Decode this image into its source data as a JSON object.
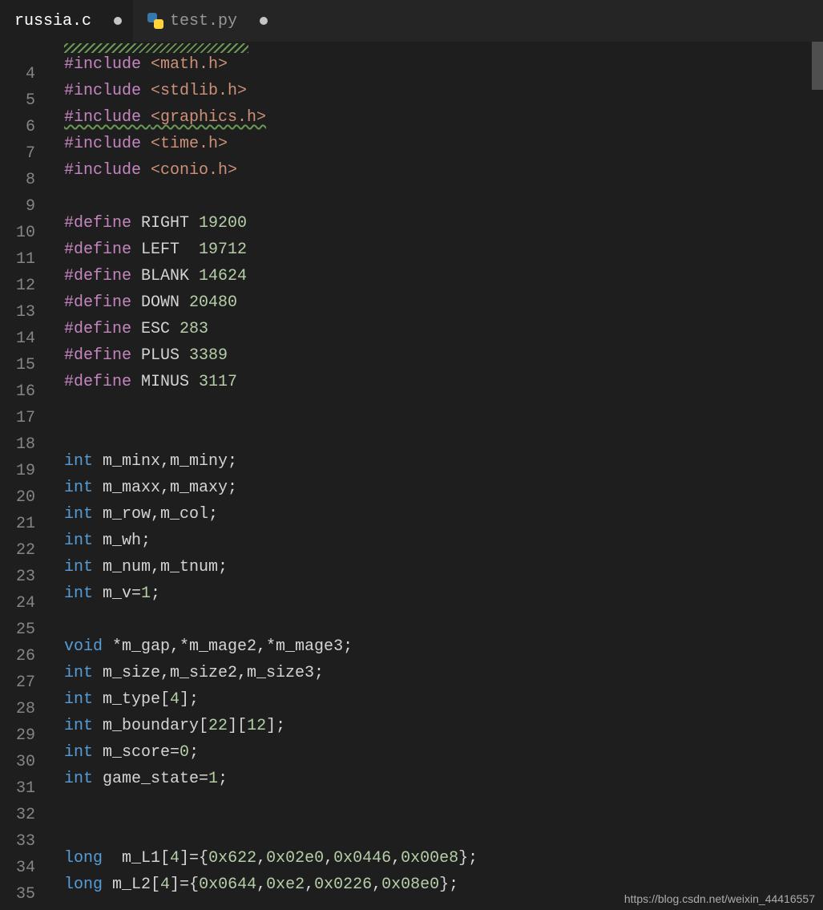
{
  "tabs": [
    {
      "label": "russia.c",
      "active": true,
      "icon": null,
      "modified": true
    },
    {
      "label": "test.py",
      "active": false,
      "icon": "python",
      "modified": true
    }
  ],
  "line_start": 4,
  "lines": [
    {
      "n": 4,
      "tokens": [
        {
          "t": "#include ",
          "c": "tok-pp"
        },
        {
          "t": "<math.h>",
          "c": "tok-hdr"
        }
      ]
    },
    {
      "n": 5,
      "tokens": [
        {
          "t": "#include ",
          "c": "tok-pp"
        },
        {
          "t": "<stdlib.h>",
          "c": "tok-hdr"
        }
      ]
    },
    {
      "n": 6,
      "tokens": [
        {
          "t": "#include ",
          "c": "tok-pp",
          "sq": true
        },
        {
          "t": "<graphics.h>",
          "c": "tok-hdr",
          "sq": true
        }
      ]
    },
    {
      "n": 7,
      "tokens": [
        {
          "t": "#include ",
          "c": "tok-pp"
        },
        {
          "t": "<time.h>",
          "c": "tok-hdr"
        }
      ]
    },
    {
      "n": 8,
      "tokens": [
        {
          "t": "#include ",
          "c": "tok-pp"
        },
        {
          "t": "<conio.h>",
          "c": "tok-hdr"
        }
      ]
    },
    {
      "n": 9,
      "tokens": []
    },
    {
      "n": 10,
      "tokens": [
        {
          "t": "#define",
          "c": "tok-pp"
        },
        {
          "t": " RIGHT ",
          "c": "tok-macro"
        },
        {
          "t": "19200",
          "c": "tok-num"
        }
      ]
    },
    {
      "n": 11,
      "tokens": [
        {
          "t": "#define",
          "c": "tok-pp"
        },
        {
          "t": " LEFT  ",
          "c": "tok-macro"
        },
        {
          "t": "19712",
          "c": "tok-num"
        }
      ]
    },
    {
      "n": 12,
      "tokens": [
        {
          "t": "#define",
          "c": "tok-pp"
        },
        {
          "t": " BLANK ",
          "c": "tok-macro"
        },
        {
          "t": "14624",
          "c": "tok-num"
        }
      ]
    },
    {
      "n": 13,
      "tokens": [
        {
          "t": "#define",
          "c": "tok-pp"
        },
        {
          "t": " DOWN ",
          "c": "tok-macro"
        },
        {
          "t": "20480",
          "c": "tok-num"
        }
      ]
    },
    {
      "n": 14,
      "tokens": [
        {
          "t": "#define",
          "c": "tok-pp"
        },
        {
          "t": " ESC ",
          "c": "tok-macro"
        },
        {
          "t": "283",
          "c": "tok-num"
        }
      ]
    },
    {
      "n": 15,
      "tokens": [
        {
          "t": "#define",
          "c": "tok-pp"
        },
        {
          "t": " PLUS ",
          "c": "tok-macro"
        },
        {
          "t": "3389",
          "c": "tok-num"
        }
      ]
    },
    {
      "n": 16,
      "tokens": [
        {
          "t": "#define",
          "c": "tok-pp"
        },
        {
          "t": " MINUS ",
          "c": "tok-macro"
        },
        {
          "t": "3117",
          "c": "tok-num"
        }
      ]
    },
    {
      "n": 17,
      "tokens": []
    },
    {
      "n": 18,
      "tokens": []
    },
    {
      "n": 19,
      "tokens": [
        {
          "t": "int",
          "c": "tok-kw"
        },
        {
          "t": " m_minx,m_miny;",
          "c": "tok-id"
        }
      ]
    },
    {
      "n": 20,
      "tokens": [
        {
          "t": "int",
          "c": "tok-kw"
        },
        {
          "t": " m_maxx,m_maxy;",
          "c": "tok-id"
        }
      ]
    },
    {
      "n": 21,
      "tokens": [
        {
          "t": "int",
          "c": "tok-kw"
        },
        {
          "t": " m_row,m_col;",
          "c": "tok-id"
        }
      ]
    },
    {
      "n": 22,
      "tokens": [
        {
          "t": "int",
          "c": "tok-kw"
        },
        {
          "t": " m_wh;",
          "c": "tok-id"
        }
      ]
    },
    {
      "n": 23,
      "tokens": [
        {
          "t": "int",
          "c": "tok-kw"
        },
        {
          "t": " m_num,m_tnum;",
          "c": "tok-id"
        }
      ]
    },
    {
      "n": 24,
      "tokens": [
        {
          "t": "int",
          "c": "tok-kw"
        },
        {
          "t": " m_v=",
          "c": "tok-id"
        },
        {
          "t": "1",
          "c": "tok-num"
        },
        {
          "t": ";",
          "c": "tok-id"
        }
      ]
    },
    {
      "n": 25,
      "tokens": []
    },
    {
      "n": 26,
      "tokens": [
        {
          "t": "void",
          "c": "tok-kw"
        },
        {
          "t": " *m_gap,*m_mage2,*m_mage3;",
          "c": "tok-id"
        }
      ]
    },
    {
      "n": 27,
      "tokens": [
        {
          "t": "int",
          "c": "tok-kw"
        },
        {
          "t": " m_size,m_size2,m_size3;",
          "c": "tok-id"
        }
      ]
    },
    {
      "n": 28,
      "tokens": [
        {
          "t": "int",
          "c": "tok-kw"
        },
        {
          "t": " m_type[",
          "c": "tok-id"
        },
        {
          "t": "4",
          "c": "tok-num"
        },
        {
          "t": "];",
          "c": "tok-id"
        }
      ]
    },
    {
      "n": 29,
      "tokens": [
        {
          "t": "int",
          "c": "tok-kw"
        },
        {
          "t": " m_boundary[",
          "c": "tok-id"
        },
        {
          "t": "22",
          "c": "tok-num"
        },
        {
          "t": "][",
          "c": "tok-id"
        },
        {
          "t": "12",
          "c": "tok-num"
        },
        {
          "t": "];",
          "c": "tok-id"
        }
      ]
    },
    {
      "n": 30,
      "tokens": [
        {
          "t": "int",
          "c": "tok-kw"
        },
        {
          "t": " m_score=",
          "c": "tok-id"
        },
        {
          "t": "0",
          "c": "tok-num"
        },
        {
          "t": ";",
          "c": "tok-id"
        }
      ]
    },
    {
      "n": 31,
      "tokens": [
        {
          "t": "int",
          "c": "tok-kw"
        },
        {
          "t": " game_state=",
          "c": "tok-id"
        },
        {
          "t": "1",
          "c": "tok-num"
        },
        {
          "t": ";",
          "c": "tok-id"
        }
      ]
    },
    {
      "n": 32,
      "tokens": []
    },
    {
      "n": 33,
      "tokens": []
    },
    {
      "n": 34,
      "tokens": [
        {
          "t": "long",
          "c": "tok-kw"
        },
        {
          "t": "  m_L1[",
          "c": "tok-id"
        },
        {
          "t": "4",
          "c": "tok-num"
        },
        {
          "t": "]={",
          "c": "tok-id"
        },
        {
          "t": "0x622",
          "c": "tok-num"
        },
        {
          "t": ",",
          "c": "tok-id"
        },
        {
          "t": "0x02e0",
          "c": "tok-num"
        },
        {
          "t": ",",
          "c": "tok-id"
        },
        {
          "t": "0x0446",
          "c": "tok-num"
        },
        {
          "t": ",",
          "c": "tok-id"
        },
        {
          "t": "0x00e8",
          "c": "tok-num"
        },
        {
          "t": "};",
          "c": "tok-id"
        }
      ]
    },
    {
      "n": 35,
      "tokens": [
        {
          "t": "long",
          "c": "tok-kw"
        },
        {
          "t": " m_L2[",
          "c": "tok-id"
        },
        {
          "t": "4",
          "c": "tok-num"
        },
        {
          "t": "]={",
          "c": "tok-id"
        },
        {
          "t": "0x0644",
          "c": "tok-num"
        },
        {
          "t": ",",
          "c": "tok-id"
        },
        {
          "t": "0xe2",
          "c": "tok-num"
        },
        {
          "t": ",",
          "c": "tok-id"
        },
        {
          "t": "0x0226",
          "c": "tok-num"
        },
        {
          "t": ",",
          "c": "tok-id"
        },
        {
          "t": "0x08e0",
          "c": "tok-num"
        },
        {
          "t": "};",
          "c": "tok-id"
        }
      ]
    }
  ],
  "watermark": "https://blog.csdn.net/weixin_44416557",
  "show_top_wavy": true
}
